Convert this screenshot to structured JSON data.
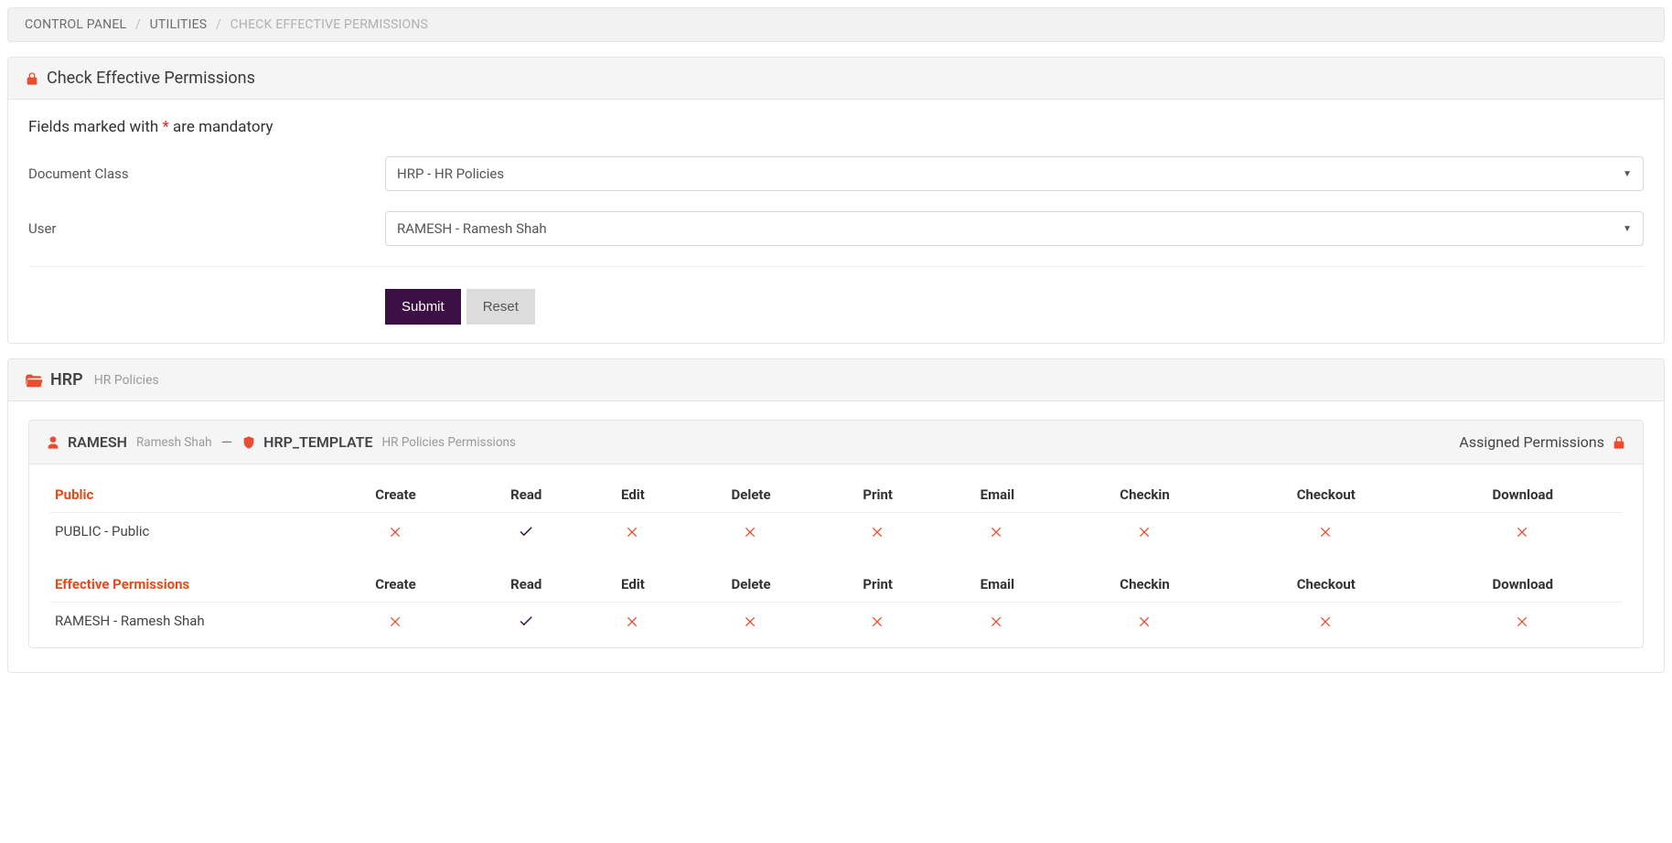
{
  "breadcrumb": {
    "items": [
      "CONTROL PANEL",
      "UTILITIES",
      "CHECK EFFECTIVE PERMISSIONS"
    ]
  },
  "formPanel": {
    "title": "Check Effective Permissions",
    "mandatoryPrefix": "Fields marked with ",
    "mandatoryStar": "*",
    "mandatorySuffix": " are mandatory",
    "documentClassLabel": "Document Class",
    "documentClassValue": "HRP - HR Policies",
    "userLabel": "User",
    "userValue": "RAMESH - Ramesh Shah",
    "submitLabel": "Submit",
    "resetLabel": "Reset"
  },
  "resultPanel": {
    "code": "HRP",
    "name": "HR Policies",
    "userCode": "RAMESH",
    "userName": "Ramesh Shah",
    "templateCode": "HRP_TEMPLATE",
    "templateName": "HR Policies Permissions",
    "assignedLabel": "Assigned Permissions",
    "columns": [
      "Create",
      "Read",
      "Edit",
      "Delete",
      "Print",
      "Email",
      "Checkin",
      "Checkout",
      "Download"
    ],
    "groups": [
      {
        "title": "Public",
        "row": {
          "label": "PUBLIC - Public",
          "values": [
            false,
            true,
            false,
            false,
            false,
            false,
            false,
            false,
            false
          ]
        }
      },
      {
        "title": "Effective Permissions",
        "row": {
          "label": "RAMESH - Ramesh Shah",
          "values": [
            false,
            true,
            false,
            false,
            false,
            false,
            false,
            false,
            false
          ]
        }
      }
    ]
  }
}
